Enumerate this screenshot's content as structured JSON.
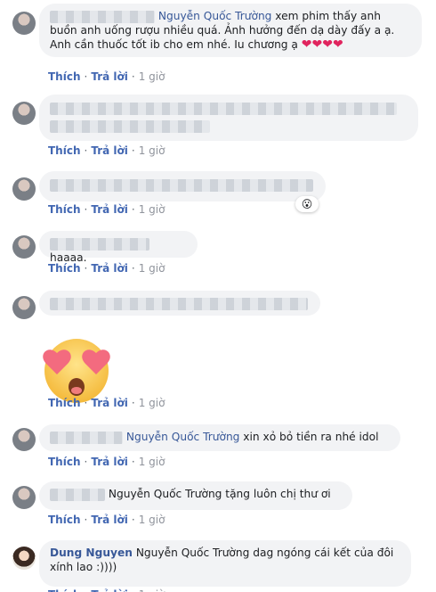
{
  "actions": {
    "like": "Thích",
    "reply": "Trả lời",
    "sep": "·",
    "time": "1 giờ"
  },
  "comments": [
    {
      "tag": "Nguyễn Quốc Trường",
      "text_after_tag": " xem phim thấy anh buồn anh uống rượu nhiều quá. Ảnh hưởng đến dạ dày đấy a ạ. Anh cần thuốc tốt ib cho em nhé. Iu chương ạ",
      "hearts": [
        "❤",
        "❤",
        "❤",
        "❤"
      ]
    },
    {
      "text": ""
    },
    {
      "text": "",
      "reaction_icon": "surprised-face-icon"
    },
    {
      "text": "haaaa."
    },
    {
      "text": "",
      "sticker": "heart-eyes-emoji"
    },
    {
      "tag": "Nguyễn Quốc Trường",
      "text_after_tag": " xin xỏ bỏ tiền ra nhé idol"
    },
    {
      "tag": "Nguyễn Quốc Trường",
      "text_after_tag": " tặng luôn chị thư ơi"
    },
    {
      "author": "Dung Nguyen",
      "tag": "Nguyễn Quốc Trường",
      "text_after_tag": " dag ngóng cái kết của đôi xính lao :))))"
    }
  ]
}
